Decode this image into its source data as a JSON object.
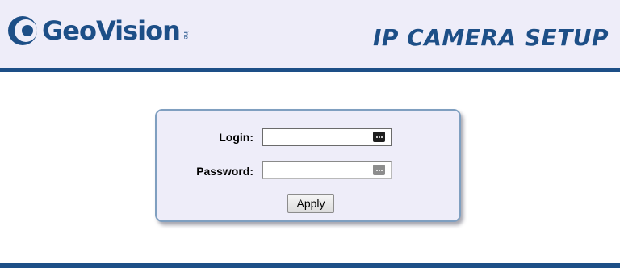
{
  "header": {
    "logo_text": "GeoVision",
    "logo_inc": "inc",
    "title": "IP CAMERA SETUP"
  },
  "login_form": {
    "login_label": "Login:",
    "login_value": "",
    "password_label": "Password:",
    "password_value": "",
    "apply_label": "Apply"
  },
  "icons": {
    "logo": "geovision-logo-icon",
    "login_field_icon": "password-manager-key-icon",
    "password_field_icon": "password-manager-key-icon"
  },
  "colors": {
    "brand_blue": "#1d4f87",
    "header_background": "#eeedf9",
    "box_background": "#eeedf9",
    "box_border": "#7f9fc0"
  }
}
